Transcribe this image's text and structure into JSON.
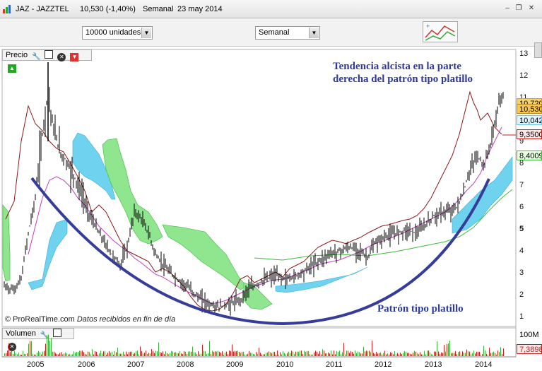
{
  "window": {
    "ticker": "JAZ - JAZZTEL",
    "price": "10,530 (-1,40%)",
    "period": "Semanal",
    "date": "23 may 2014"
  },
  "toolbar": {
    "units_value": "10000 unidades",
    "period_value": "Semanal"
  },
  "price_panel": {
    "title": "Precio",
    "y_ticks": [
      "13",
      "12",
      "11",
      "10",
      "9",
      "8",
      "7",
      "6",
      "5",
      "4",
      "3",
      "2",
      "1"
    ],
    "price_tags": [
      {
        "label": "10,720",
        "color": "#f7d26b",
        "border": "#c9a030"
      },
      {
        "label": "10,530",
        "color": "#f9c74f",
        "border": "#b58a1a"
      },
      {
        "label": "10,042",
        "color": "#dff6ff",
        "border": "#6cc6e8"
      },
      {
        "label": "9,3500",
        "color": "#ffe7e7",
        "border": "#c02020"
      },
      {
        "label": "8,4009",
        "color": "#e8ffe0",
        "border": "#3bbb3b"
      }
    ],
    "annotation_top_line1": "Tendencia alcista en la parte",
    "annotation_top_line2": "derecha del patrón tipo platillo",
    "annotation_bottom": "Patrón tipo platillo",
    "copyright": "© ProRealTime.com",
    "copyright_note": "Datos recibidos en fin de día"
  },
  "volume_panel": {
    "title": "Volumen",
    "y_tick": "100M",
    "tag": "7,3898"
  },
  "x_ticks": [
    "2005",
    "2006",
    "2007",
    "2008",
    "2009",
    "2010",
    "2011",
    "2012",
    "2013",
    "2014"
  ],
  "colors": {
    "annotation": "#2e3a9e",
    "saucer": "#353c9a",
    "candles": "#000000",
    "ma_red": "#8b1a1a",
    "ma_magenta": "#c040c0",
    "cloud_cyan": "#6fd3ef",
    "cloud_green": "#8fe68f",
    "volume_green": "#3cb043",
    "volume_red": "#cc2222"
  }
}
